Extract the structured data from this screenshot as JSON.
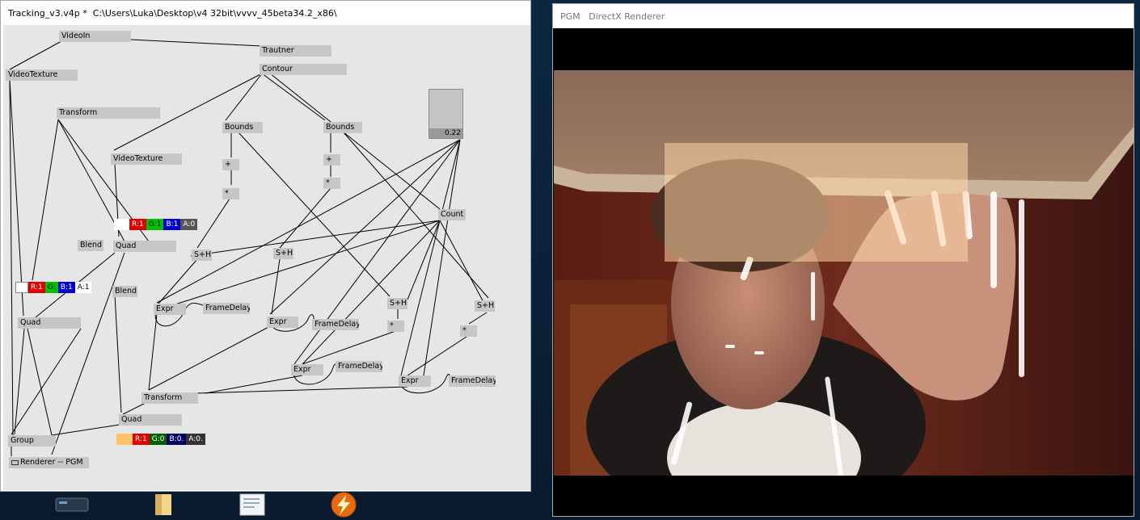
{
  "left_window": {
    "title": "Tracking_v3.v4p *  C:\\Users\\Luka\\Desktop\\v4 32bit\\vvvv_45beta34.2_x86\\"
  },
  "patch": {
    "nodes": {
      "videoin": "VideoIn",
      "trautner": "Trautner",
      "contour": "Contour",
      "videotexture1": "VideoTexture",
      "transform1": "Transform",
      "videotexture2": "VideoTexture",
      "bounds1": "Bounds",
      "bounds2": "Bounds",
      "plus1": "+",
      "plus2": "+",
      "mul1": "*",
      "mul2": "*",
      "mul3": "*",
      "mul4": "*",
      "count": "Count",
      "blend1": "Blend",
      "quad1": "Quad",
      "sh1": "S+H",
      "sh2": "S+H",
      "sh3": "S+H",
      "sh4": "S+H",
      "blend2": "Blend",
      "expr1": "Expr",
      "expr2": "Expr",
      "expr3": "Expr",
      "expr4": "Expr",
      "framedelay1": "FrameDelay",
      "framedelay2": "FrameDelay",
      "framedelay3": "FrameDelay",
      "framedelay4": "FrameDelay",
      "quad2": "Quad",
      "transform2": "Transform",
      "quad3": "Quad",
      "group": "Group",
      "renderer": "Renderer -- PGM"
    },
    "color1": {
      "r": "R:1",
      "g": "G:1",
      "b": "B:1",
      "a": "A:0"
    },
    "color2": {
      "r": "R:1",
      "g": "G:",
      "b": "B:1",
      "a": "A:1"
    },
    "color3": {
      "r": "R:1",
      "g": "G:0",
      "b": "B:0.",
      "a": "A:0."
    },
    "slider_value": "0.22"
  },
  "right_window": {
    "title": "PGM   DirectX Renderer"
  },
  "colors": {
    "red": "#e00000",
    "green": "#00c000",
    "blue": "#0000d0",
    "orange_swatch": "#ffc36a",
    "tracking_box": "#ffd7a8"
  },
  "taskbar": {
    "icons": [
      "vvvv-icon",
      "folder-icon",
      "document-icon",
      "flash-icon"
    ]
  }
}
